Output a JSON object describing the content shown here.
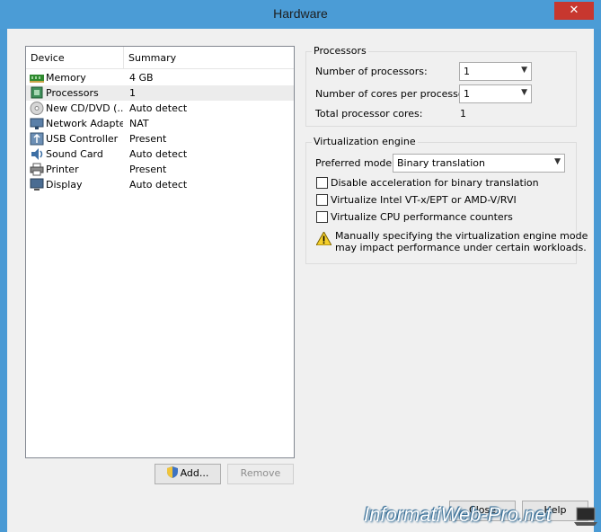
{
  "window": {
    "title": "Hardware",
    "close_glyph": "✕"
  },
  "device_list": {
    "columns": [
      "Device",
      "Summary"
    ],
    "items": [
      {
        "name": "Memory",
        "summary": "4 GB",
        "icon": "memory-icon",
        "selected": false
      },
      {
        "name": "Processors",
        "summary": "1",
        "icon": "processor-icon",
        "selected": true
      },
      {
        "name": "New CD/DVD (...",
        "summary": "Auto detect",
        "icon": "cd-dvd-icon",
        "selected": false
      },
      {
        "name": "Network Adapter",
        "summary": "NAT",
        "icon": "network-adapter-icon",
        "selected": false
      },
      {
        "name": "USB Controller",
        "summary": "Present",
        "icon": "usb-icon",
        "selected": false
      },
      {
        "name": "Sound Card",
        "summary": "Auto detect",
        "icon": "sound-card-icon",
        "selected": false
      },
      {
        "name": "Printer",
        "summary": "Present",
        "icon": "printer-icon",
        "selected": false
      },
      {
        "name": "Display",
        "summary": "Auto detect",
        "icon": "display-icon",
        "selected": false
      }
    ],
    "add_label": "Add...",
    "remove_label": "Remove"
  },
  "processors": {
    "group_label": "Processors",
    "num_processors_label": "Number of processors:",
    "num_processors_value": "1",
    "cores_label": "Number of cores per processor:",
    "cores_value": "1",
    "total_label": "Total processor cores:",
    "total_value": "1"
  },
  "virtualization": {
    "group_label": "Virtualization engine",
    "mode_label": "Preferred mode:",
    "mode_value": "Binary translation",
    "options": [
      {
        "label": "Disable acceleration for binary translation",
        "checked": false
      },
      {
        "label": "Virtualize Intel VT-x/EPT or AMD-V/RVI",
        "checked": false
      },
      {
        "label": "Virtualize CPU performance counters",
        "checked": false
      }
    ],
    "warning_line1": "Manually specifying the virtualization engine mode",
    "warning_line2": "may impact performance under certain workloads."
  },
  "footer": {
    "close_label": "Close",
    "help_label": "Help"
  },
  "watermark": "InformatiWeb-Pro.net",
  "colors": {
    "titlebar": "#4b9cd6",
    "close_button": "#c7372f",
    "dialog_bg": "#f0f0f0"
  }
}
